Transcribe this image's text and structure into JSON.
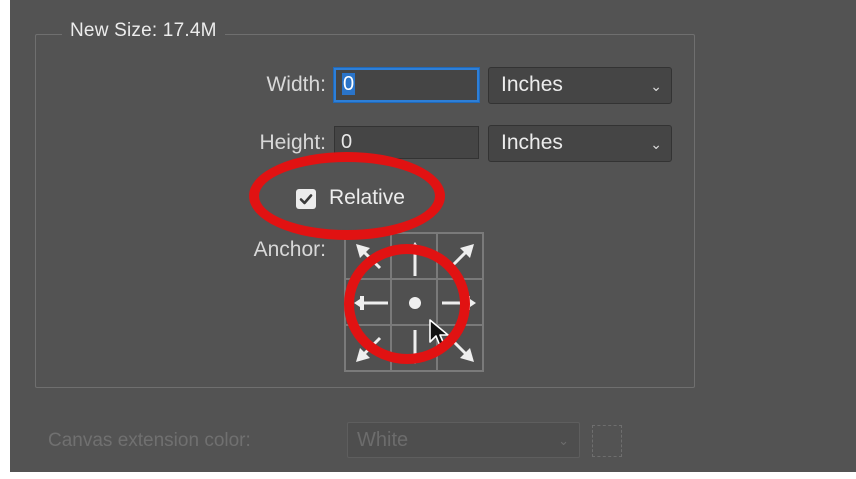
{
  "group": {
    "legend": "New Size: 17.4M"
  },
  "width": {
    "label": "Width:",
    "value": "0",
    "unit": "Inches"
  },
  "height": {
    "label": "Height:",
    "value": "0",
    "unit": "Inches"
  },
  "relative": {
    "label": "Relative",
    "checked": true
  },
  "anchor": {
    "label": "Anchor:",
    "selected": "center"
  },
  "canvas_extension": {
    "label": "Canvas extension color:",
    "value": "White",
    "enabled": false
  },
  "icons": {
    "dropdown": "chevron-down-icon",
    "checkbox": "checkmark-icon",
    "cursor": "mouse-pointer-icon"
  },
  "colors": {
    "panel": "#535353",
    "highlight_ring": "#e11212",
    "focus": "#2d7fd8"
  }
}
